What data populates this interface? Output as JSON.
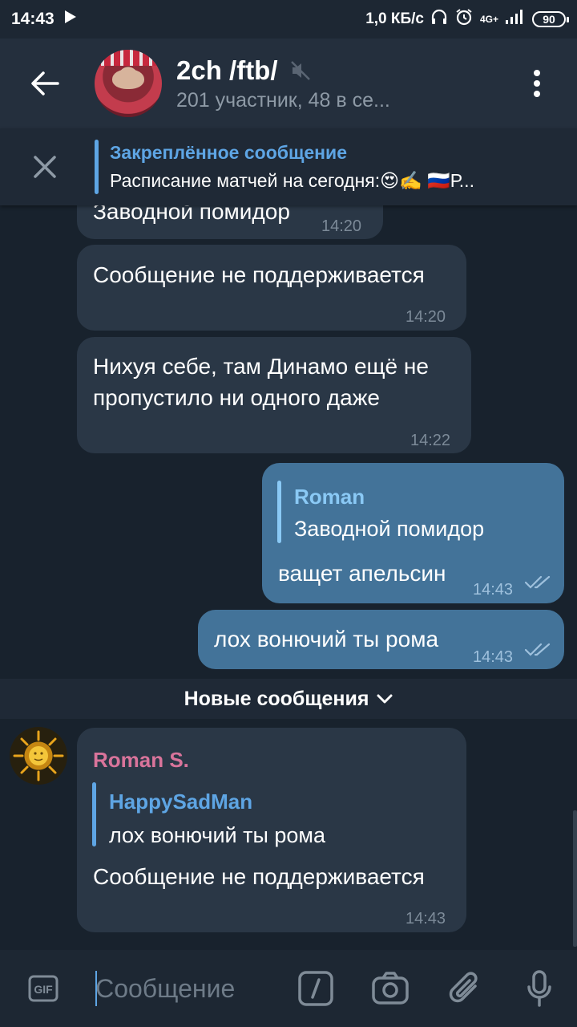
{
  "status_bar": {
    "time": "14:43",
    "speed": "1,0 КБ/с",
    "network": "4G+",
    "battery": "90"
  },
  "header": {
    "title": "2ch /ftb/",
    "subtitle": "201 участник, 48 в се..."
  },
  "pinned": {
    "title": "Закреплённое сообщение",
    "text": "Расписание матчей на сегодня:😍✍️  🇷🇺Р..."
  },
  "messages": [
    {
      "text": "Заводной помидор",
      "time": "14:20"
    },
    {
      "text": "Сообщение не поддерживается",
      "time": "14:20"
    },
    {
      "text_line1": "Нихуя себе, там Динамо ещё не",
      "text_line2": "пропустило ни одного даже",
      "time": "14:22"
    },
    {
      "reply_name": "Roman",
      "reply_text": "Заводной помидор",
      "text": "ващет апельсин",
      "time": "14:43"
    },
    {
      "text": "лох вонючий ты рома",
      "time": "14:43"
    }
  ],
  "new_messages_label": "Новые сообщения",
  "incoming": {
    "sender": "Roman S.",
    "reply_name": "HappySadMan",
    "reply_text": "лох вонючий ты рома",
    "text": "Сообщение не поддерживается",
    "time": "14:43"
  },
  "input": {
    "placeholder": "Сообщение"
  },
  "colors": {
    "background": "#18222d",
    "header": "#242f3d",
    "incoming_bubble": "#2a3746",
    "outgoing_bubble": "#437399",
    "accent": "#5ea5e4",
    "sender_name": "#d9749b"
  },
  "icons": [
    "back-arrow-icon",
    "muted-speaker-icon",
    "more-vert-icon",
    "close-icon",
    "double-check-icon",
    "chevron-down-icon",
    "gif-icon",
    "slash-command-icon",
    "camera-icon",
    "paperclip-icon",
    "microphone-icon"
  ]
}
